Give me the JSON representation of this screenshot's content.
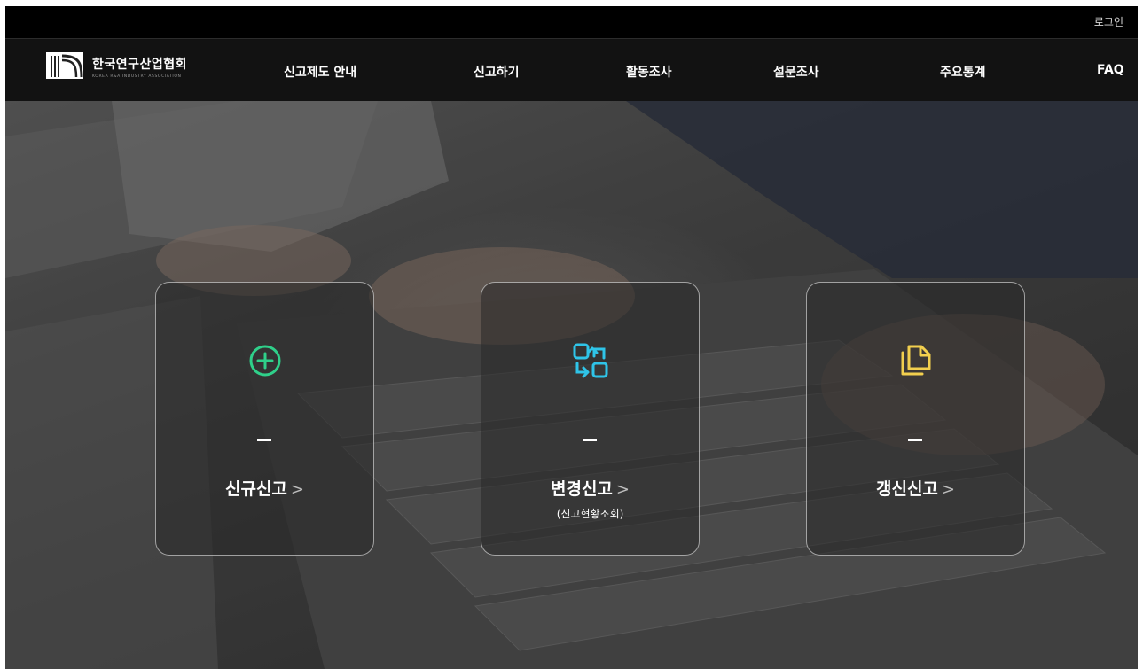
{
  "topbar": {
    "login_label": "로그인"
  },
  "brand": {
    "name_ko": "한국연구산업협회",
    "name_en": "KOREA R&A INDUSTRY ASSOCIATION"
  },
  "nav": {
    "items": [
      {
        "label": "신고제도 안내"
      },
      {
        "label": "신고하기"
      },
      {
        "label": "활동조사"
      },
      {
        "label": "설문조사"
      },
      {
        "label": "주요통계"
      },
      {
        "label": "FAQ"
      }
    ]
  },
  "cards": [
    {
      "title": "신규신고",
      "chevron": ">",
      "icon": "plus-circle-icon",
      "color": "#2fd08a"
    },
    {
      "title": "변경신고",
      "chevron": ">",
      "subtitle": "(신고현황조회)",
      "icon": "swap-icon",
      "color": "#2fc4e8"
    },
    {
      "title": "갱신신고",
      "chevron": ">",
      "icon": "copy-icon",
      "color": "#f2cf4e"
    }
  ]
}
